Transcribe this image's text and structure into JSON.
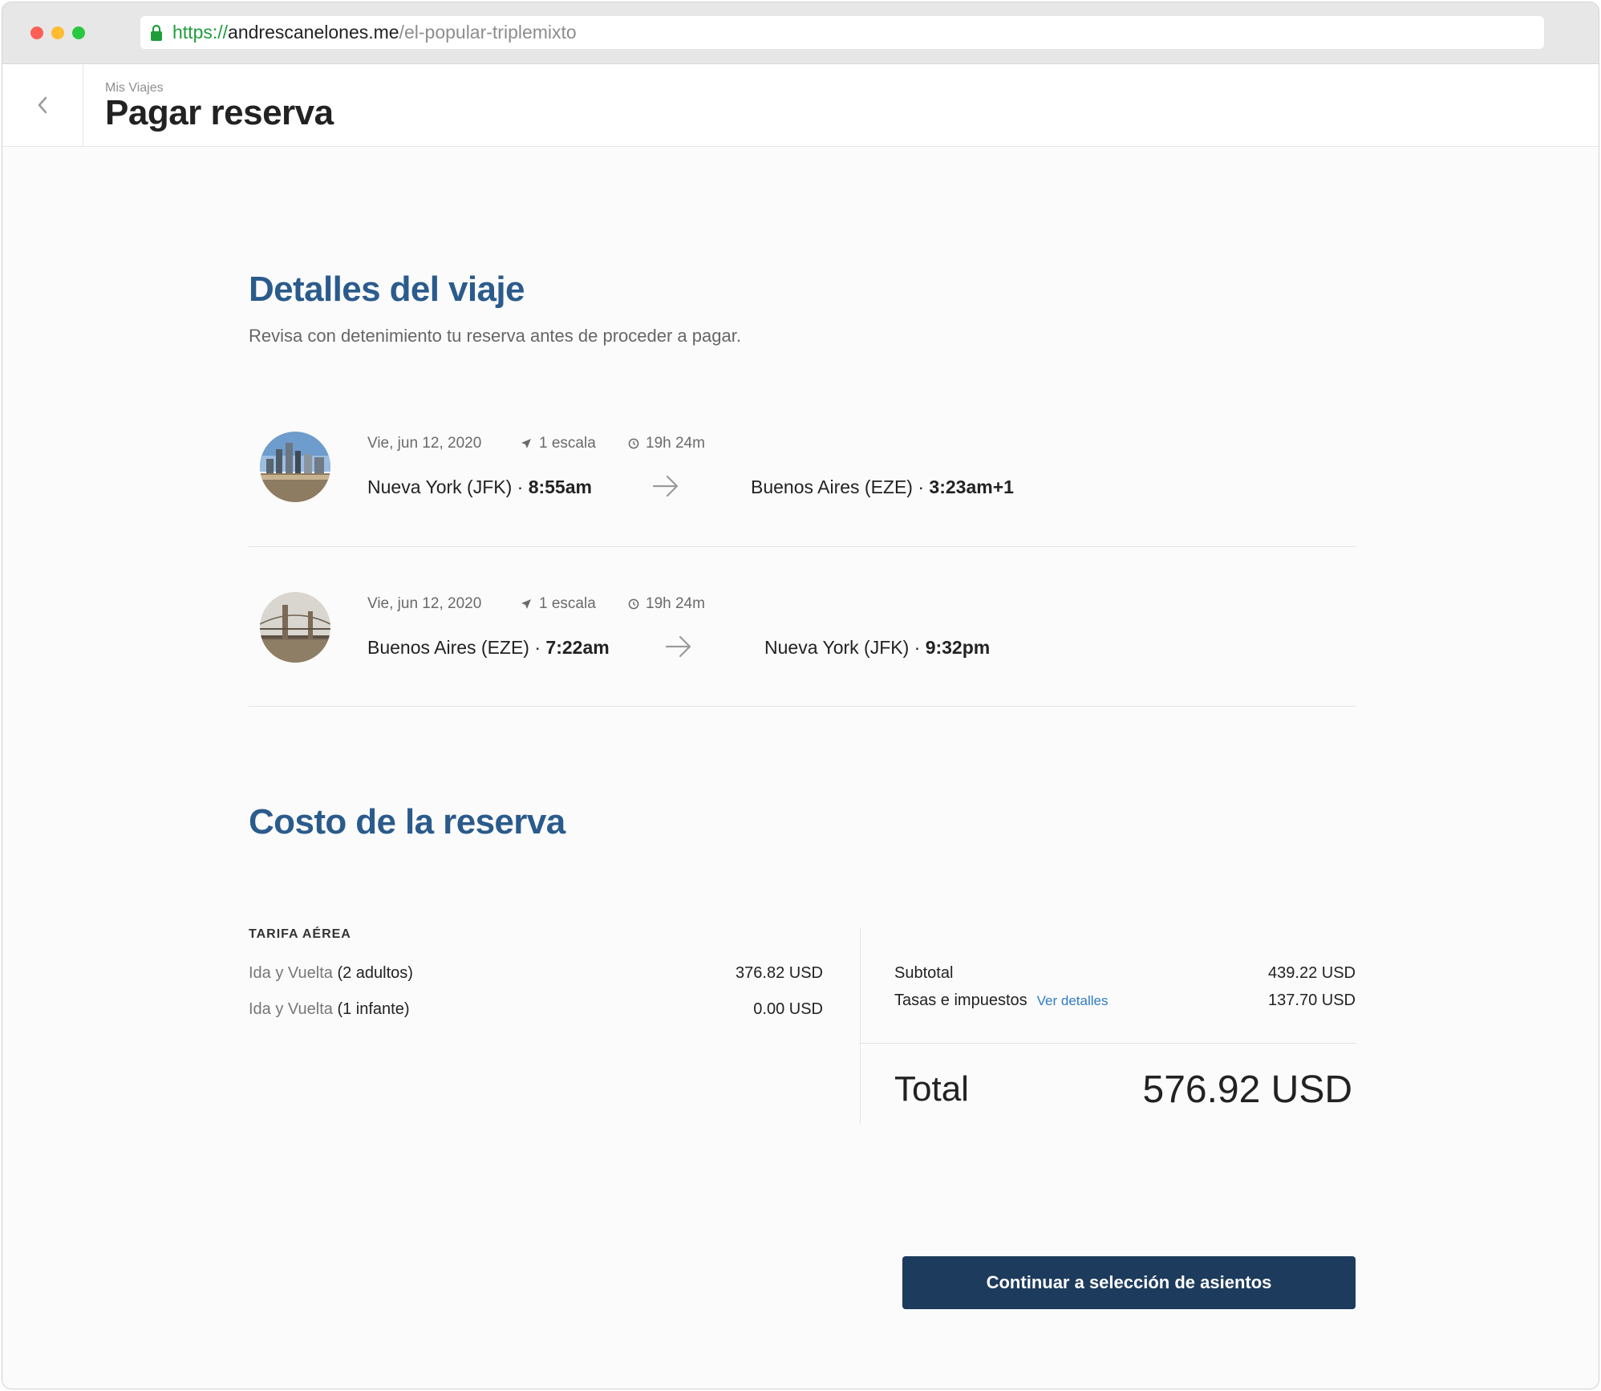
{
  "browser": {
    "url_scheme": "https://",
    "url_host": "andrescanelones.me",
    "url_path": "/el-popular-triplemixto"
  },
  "header": {
    "breadcrumb": "Mis Viajes",
    "title": "Pagar reserva"
  },
  "trip": {
    "title": "Detalles del viaje",
    "subtitle": "Revisa con detenimiento tu reserva antes de proceder a pagar.",
    "flights": [
      {
        "date": "Vie, jun 12, 2020",
        "stops": "1 escala",
        "duration": "19h 24m",
        "origin": "Nueva York (JFK) · ",
        "depart_time": "8:55am",
        "destination": "Buenos Aires (EZE) · ",
        "arrive_time": "3:23am+1"
      },
      {
        "date": "Vie, jun 12, 2020",
        "stops": "1 escala",
        "duration": "19h 24m",
        "origin": "Buenos Aires (EZE) · ",
        "depart_time": "7:22am",
        "destination": "Nueva York (JFK) · ",
        "arrive_time": "9:32pm"
      }
    ]
  },
  "cost": {
    "title": "Costo de la reserva",
    "fare_label": "TARIFA AÉREA",
    "lines": [
      {
        "label": "Ida y Vuelta ",
        "detail": "(2 adultos)",
        "amount": "376.82 USD"
      },
      {
        "label": "Ida y Vuelta ",
        "detail": "(1 infante)",
        "amount": "0.00 USD"
      }
    ],
    "subtotal_label": "Subtotal",
    "subtotal_amount": "439.22 USD",
    "taxes_label": "Tasas e impuestos",
    "taxes_link": "Ver detalles",
    "taxes_amount": "137.70 USD",
    "total_label": "Total",
    "total_amount": "576.92 USD"
  },
  "cta_label": "Continuar a selección de asientos",
  "colors": {
    "accent": "#2b5b8c",
    "cta": "#1d3b5c",
    "link": "#2f7cc4"
  },
  "icons": [
    "lock-icon",
    "back-chevron-icon",
    "plane-icon",
    "clock-icon",
    "arrow-right-icon"
  ]
}
